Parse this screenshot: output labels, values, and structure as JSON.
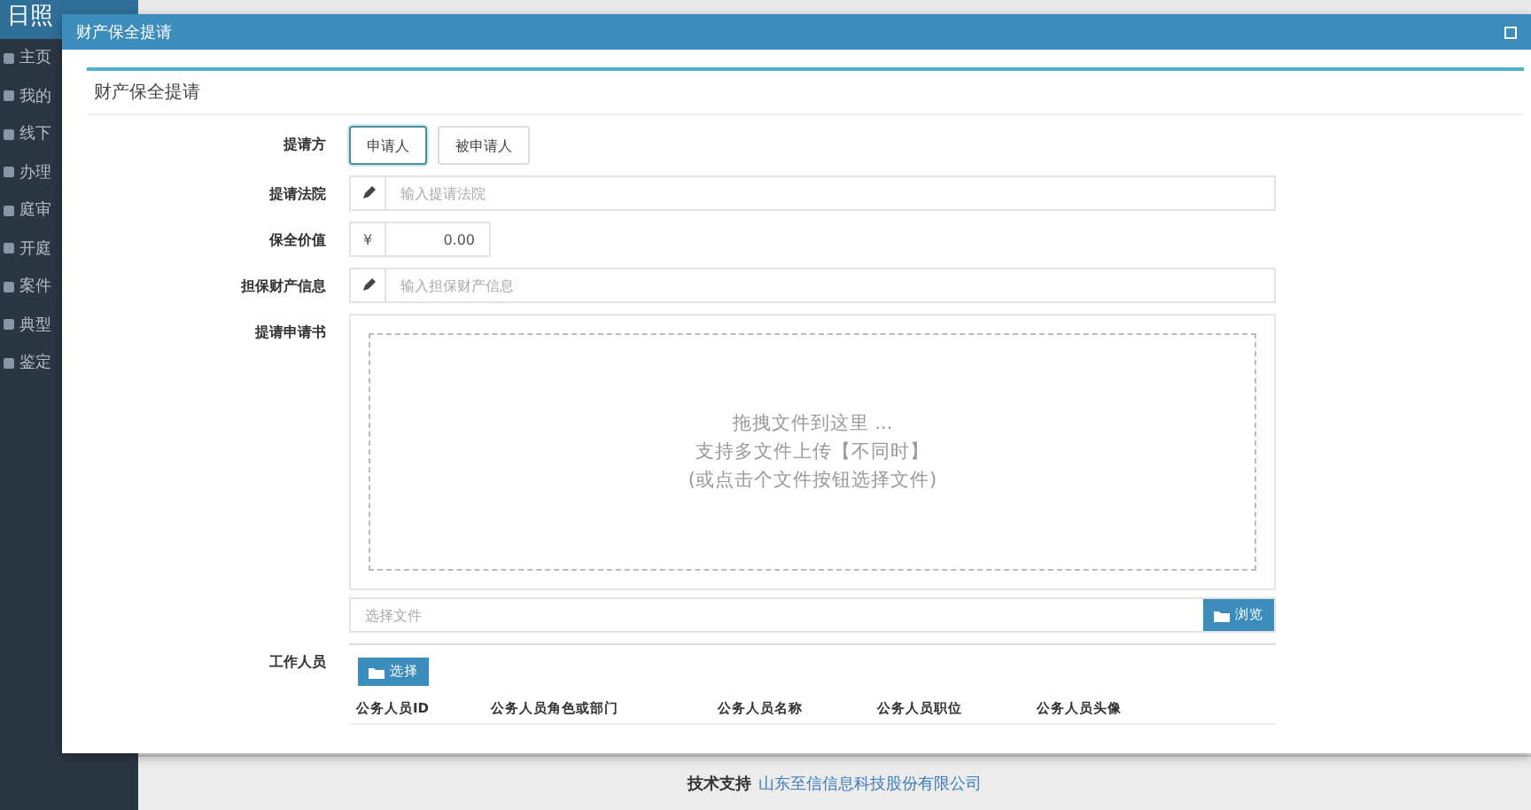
{
  "app": {
    "title": "日照",
    "sidebar": [
      {
        "label": "主页"
      },
      {
        "label": "我的"
      },
      {
        "label": "线下"
      },
      {
        "label": "办理"
      },
      {
        "label": "庭审"
      },
      {
        "label": "开庭"
      },
      {
        "label": "案件"
      },
      {
        "label": "典型"
      },
      {
        "label": "鉴定"
      }
    ]
  },
  "footer": {
    "label": "技术支持",
    "company": "山东至信信息科技股份有限公司"
  },
  "dialog": {
    "title": "财产保全提请",
    "panel_title": "财产保全提请",
    "fields": [
      {
        "kind": "toggle",
        "label": "提请方",
        "options": [
          {
            "label": "申请人",
            "selected": true
          },
          {
            "label": "被申请人",
            "selected": false
          }
        ]
      },
      {
        "kind": "text",
        "label": "提请法院",
        "placeholder": "输入提请法院"
      },
      {
        "kind": "money",
        "label": "保全价值",
        "prefix": "¥",
        "value": "0.00"
      },
      {
        "kind": "text",
        "label": "担保财产信息",
        "placeholder": "输入担保财产信息"
      },
      {
        "kind": "upload",
        "label": "提请申请书",
        "drop_lines": [
          "拖拽文件到这里 ...",
          "支持多文件上传【不同时】",
          "(或点击个文件按钮选择文件)"
        ],
        "file_placeholder": "选择文件",
        "browse": "浏览"
      },
      {
        "kind": "staff",
        "label": "工作人员",
        "button": "选择",
        "columns": [
          "公务人员ID",
          "公务人员角色或部门",
          "公务人员名称",
          "公务人员职位",
          "公务人员头像"
        ]
      }
    ]
  }
}
